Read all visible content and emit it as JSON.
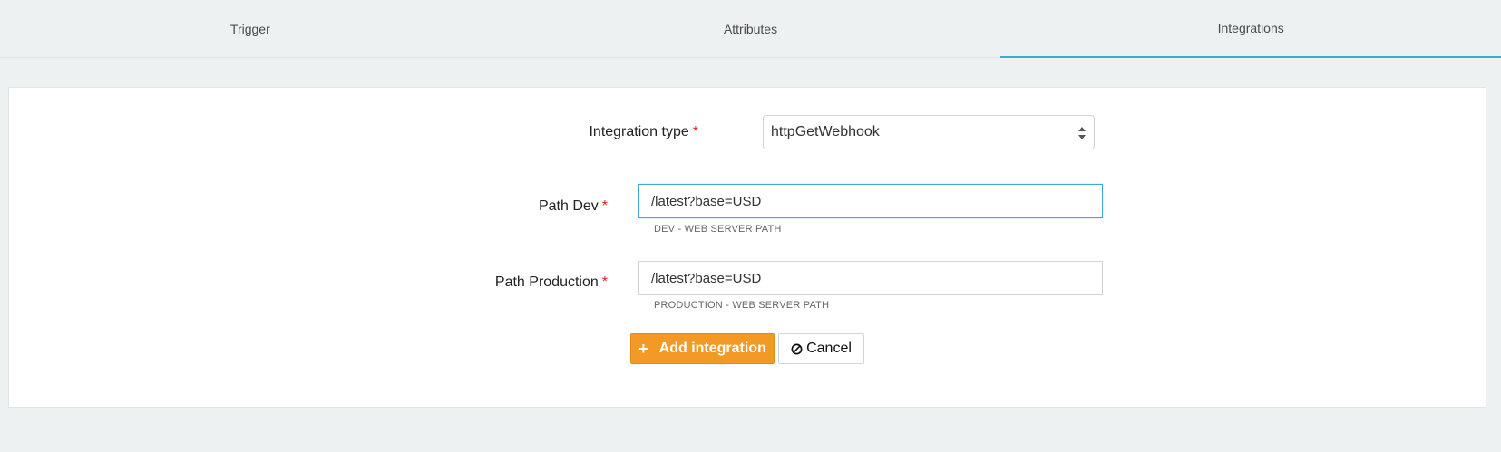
{
  "tabs": [
    {
      "label": "Trigger"
    },
    {
      "label": "Attributes"
    },
    {
      "label": "Integrations",
      "active": true
    }
  ],
  "form": {
    "integration_type": {
      "label": "Integration type",
      "value": "httpGetWebhook"
    },
    "path_dev": {
      "label": "Path Dev",
      "value": "/latest?base=USD",
      "help": "DEV - WEB SERVER PATH"
    },
    "path_production": {
      "label": "Path Production",
      "value": "/latest?base=USD",
      "help": "PRODUCTION - WEB SERVER PATH"
    },
    "required_marker": "*"
  },
  "actions": {
    "add_label": "Add integration",
    "cancel_label": "Cancel"
  },
  "colors": {
    "accent": "#3fa9d6",
    "primary_button": "#f39a26",
    "required": "#e02020",
    "background": "#edf1f2"
  },
  "icons": {
    "add": "plus-icon",
    "cancel": "ban-icon",
    "select": "select-arrows-icon"
  }
}
